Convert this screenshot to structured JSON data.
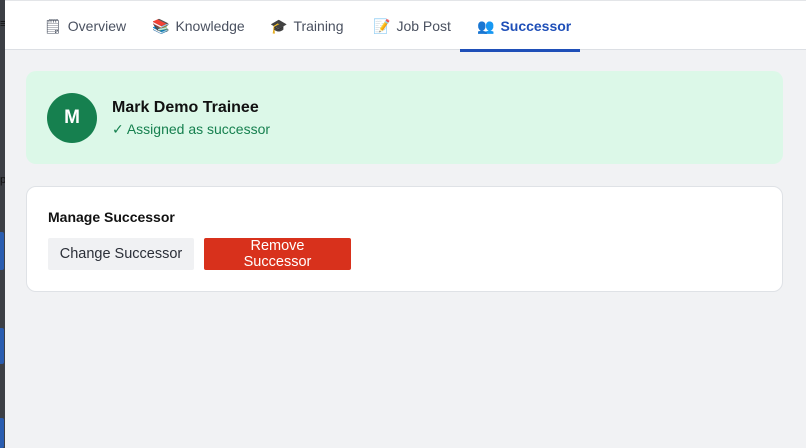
{
  "tabs": [
    {
      "label": "Overview",
      "icon": "clipboard-icon",
      "glyph": "🗒",
      "active": false
    },
    {
      "label": "Knowledge",
      "icon": "books-icon",
      "glyph": "📚",
      "active": false
    },
    {
      "label": "Training",
      "icon": "graduation-cap-icon",
      "glyph": "🎓",
      "active": false
    },
    {
      "label": "Job Post",
      "icon": "memo-icon",
      "glyph": "📝",
      "active": false
    },
    {
      "label": "Successor",
      "icon": "people-icon",
      "glyph": "👥",
      "active": true
    }
  ],
  "successor": {
    "avatar_initial": "M",
    "name": "Mark Demo Trainee",
    "status": "✓ Assigned as successor"
  },
  "manage": {
    "title": "Manage Successor",
    "change_label": "Change Successor",
    "remove_label": "Remove Successor"
  },
  "colors": {
    "accent": "#1f4fb8",
    "success_bg": "#dcf8e8",
    "success": "#16804f",
    "danger": "#d8311c"
  }
}
